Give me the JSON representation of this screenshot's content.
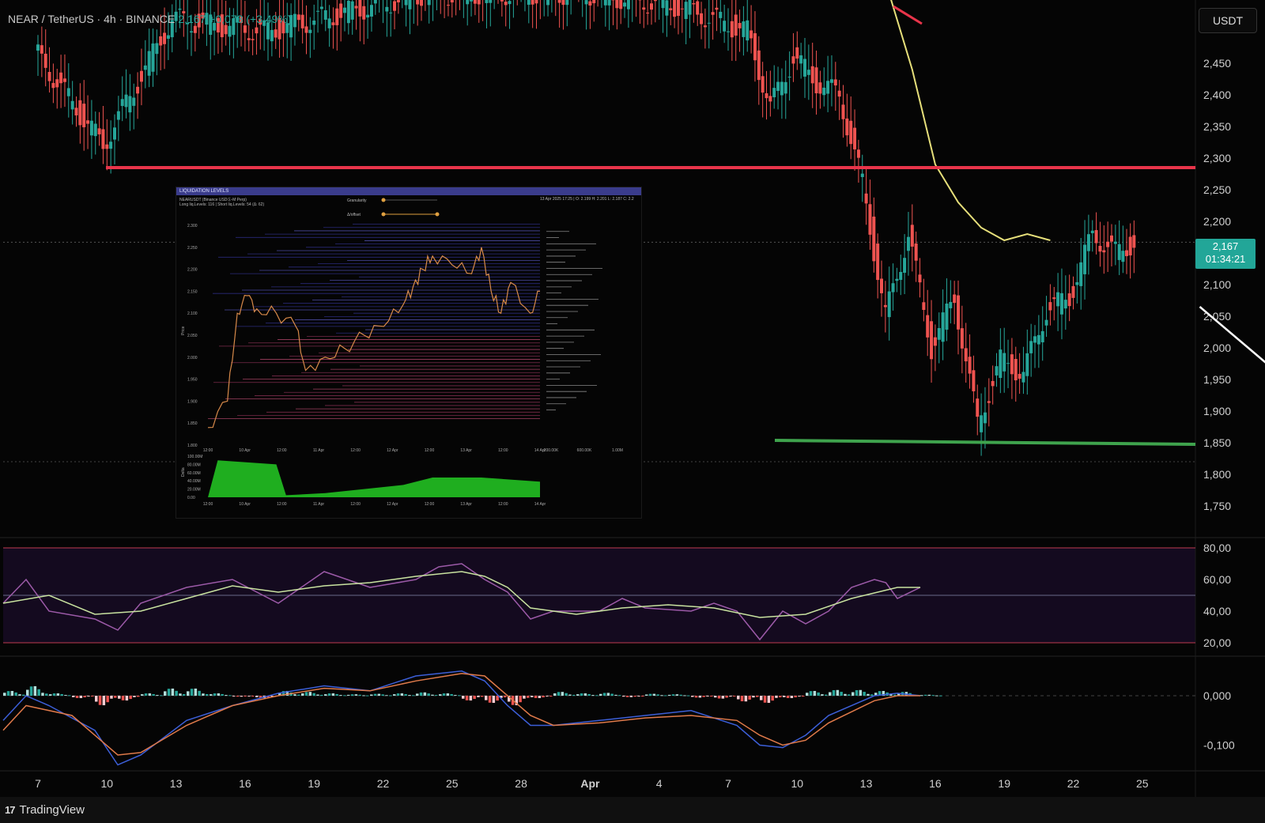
{
  "header": {
    "symbol": "NEAR / TetherUS · 4h · BINANCE",
    "price": "2,167",
    "change": "+0,073 (+3,49%)"
  },
  "currency_button": "USDT",
  "last_price": {
    "price": "2,167",
    "countdown": "01:34:21"
  },
  "footer": {
    "logo_mark": "17",
    "brand": "TradingView"
  },
  "colors": {
    "up": "#26a69a",
    "down": "#ef5350",
    "resistance": "#e8344a",
    "support": "#3fa34d",
    "ma": "#e6df7a",
    "rsi": "#9c5aa8",
    "rsi_ma": "#c9e3a0",
    "macd": "#3c5fd8",
    "signal": "#e07a4a",
    "arrow": "#ffffff"
  },
  "chart_data": [
    {
      "type": "line",
      "name": "price",
      "x": [
        "Mar 7",
        "Mar 10",
        "Mar 13",
        "Mar 16",
        "Mar 19",
        "Mar 22",
        "Mar 25",
        "Mar 28",
        "Apr 1",
        "Apr 4",
        "Apr 7",
        "Apr 10",
        "Apr 13",
        "Apr 16",
        "Apr 19",
        "Apr 22",
        "Apr 25"
      ],
      "x_tick_labels": [
        "7",
        "10",
        "13",
        "16",
        "19",
        "22",
        "25",
        "28",
        "Apr",
        "4",
        "7",
        "10",
        "13",
        "16",
        "19",
        "22",
        "25"
      ],
      "y_tick_labels": [
        "2,450",
        "2,400",
        "2,350",
        "2,300",
        "2,250",
        "2,200",
        "2,100",
        "2,050",
        "2,000",
        "1,950",
        "1,900",
        "1,850",
        "1,800",
        "1,750"
      ],
      "ylim": [
        1720,
        2490
      ],
      "path": [
        [
          0,
          2470
        ],
        [
          3,
          2320
        ],
        [
          6,
          2520
        ],
        [
          10,
          2500
        ],
        [
          17,
          2560
        ],
        [
          24,
          2560
        ],
        [
          28,
          2540
        ],
        [
          31,
          2500
        ],
        [
          32,
          2380
        ],
        [
          33,
          2460
        ],
        [
          34,
          2420
        ],
        [
          35,
          2400
        ],
        [
          36,
          2260
        ],
        [
          37,
          2050
        ],
        [
          38,
          2180
        ],
        [
          39,
          2000
        ],
        [
          40,
          2080
        ],
        [
          41,
          1880
        ],
        [
          42,
          1980
        ],
        [
          43,
          1960
        ],
        [
          44,
          2060
        ],
        [
          45,
          2080
        ],
        [
          46,
          2180
        ],
        [
          47,
          2150
        ],
        [
          47.8,
          2167
        ]
      ],
      "levels": {
        "resistance": 2285,
        "support": 1850,
        "last": 2167,
        "low": 1820
      },
      "moving_average": [
        [
          37,
          2560
        ],
        [
          38,
          2440
        ],
        [
          39,
          2290
        ],
        [
          40,
          2230
        ],
        [
          41,
          2190
        ],
        [
          42,
          2170
        ],
        [
          43,
          2180
        ],
        [
          44,
          2170
        ]
      ],
      "projection": [
        [
          50.5,
          2065
        ],
        [
          56.5,
          1880
        ],
        [
          61.3,
          2415
        ]
      ]
    },
    {
      "type": "line",
      "name": "RSI",
      "y_tick_labels": [
        "80,00",
        "60,00",
        "40,00",
        "20,00"
      ],
      "ylim": [
        15,
        85
      ],
      "bands": [
        80,
        50,
        20
      ],
      "rsi": [
        [
          0,
          45
        ],
        [
          1,
          60
        ],
        [
          2,
          40
        ],
        [
          4,
          35
        ],
        [
          5,
          28
        ],
        [
          6,
          45
        ],
        [
          8,
          55
        ],
        [
          10,
          60
        ],
        [
          12,
          45
        ],
        [
          14,
          65
        ],
        [
          16,
          55
        ],
        [
          18,
          60
        ],
        [
          19,
          68
        ],
        [
          20,
          70
        ],
        [
          21,
          60
        ],
        [
          22,
          52
        ],
        [
          23,
          35
        ],
        [
          24,
          40
        ],
        [
          26,
          40
        ],
        [
          27,
          48
        ],
        [
          28,
          42
        ],
        [
          30,
          40
        ],
        [
          31,
          45
        ],
        [
          32,
          40
        ],
        [
          33,
          22
        ],
        [
          34,
          40
        ],
        [
          35,
          32
        ],
        [
          36,
          40
        ],
        [
          37,
          55
        ],
        [
          38,
          60
        ],
        [
          38.5,
          58
        ],
        [
          39,
          48
        ],
        [
          40,
          55
        ]
      ],
      "ma": [
        [
          0,
          45
        ],
        [
          2,
          50
        ],
        [
          4,
          38
        ],
        [
          6,
          40
        ],
        [
          8,
          48
        ],
        [
          10,
          56
        ],
        [
          12,
          52
        ],
        [
          14,
          56
        ],
        [
          16,
          58
        ],
        [
          18,
          62
        ],
        [
          20,
          65
        ],
        [
          21,
          62
        ],
        [
          22,
          55
        ],
        [
          23,
          42
        ],
        [
          25,
          38
        ],
        [
          27,
          42
        ],
        [
          29,
          44
        ],
        [
          31,
          42
        ],
        [
          33,
          36
        ],
        [
          35,
          38
        ],
        [
          37,
          48
        ],
        [
          39,
          55
        ],
        [
          40,
          55
        ]
      ]
    },
    {
      "type": "bar",
      "name": "MACD",
      "y_tick_labels": [
        "0,000",
        "-0,100"
      ],
      "ylim": [
        -0.14,
        0.05
      ],
      "histogram": [
        [
          0,
          0.01
        ],
        [
          1,
          0.02
        ],
        [
          2,
          0.005
        ],
        [
          3,
          -0.005
        ],
        [
          4,
          -0.02
        ],
        [
          5,
          -0.01
        ],
        [
          6,
          0.005
        ],
        [
          7,
          0.015
        ],
        [
          8,
          0.015
        ],
        [
          9,
          0.005
        ],
        [
          10,
          -0.002
        ],
        [
          11,
          -0.005
        ],
        [
          12,
          0.01
        ],
        [
          13,
          0.008
        ],
        [
          14,
          0.005
        ],
        [
          15,
          0.003
        ],
        [
          16,
          0.004
        ],
        [
          17,
          0.005
        ],
        [
          18,
          0.007
        ],
        [
          19,
          0.005
        ],
        [
          20,
          -0.01
        ],
        [
          21,
          -0.015
        ],
        [
          22,
          -0.02
        ],
        [
          23,
          -0.005
        ],
        [
          24,
          0.008
        ],
        [
          25,
          0.005
        ],
        [
          26,
          0.006
        ],
        [
          27,
          -0.003
        ],
        [
          28,
          0.004
        ],
        [
          29,
          0.003
        ],
        [
          30,
          -0.004
        ],
        [
          31,
          -0.006
        ],
        [
          32,
          -0.012
        ],
        [
          33,
          -0.015
        ],
        [
          34,
          -0.005
        ],
        [
          35,
          0.01
        ],
        [
          36,
          0.012
        ],
        [
          37,
          0.012
        ],
        [
          38,
          0.01
        ],
        [
          39,
          0.008
        ],
        [
          40,
          0.002
        ]
      ],
      "macd": [
        [
          0,
          -0.05
        ],
        [
          1,
          0.0
        ],
        [
          2,
          -0.02
        ],
        [
          4,
          -0.07
        ],
        [
          5,
          -0.14
        ],
        [
          6,
          -0.12
        ],
        [
          8,
          -0.05
        ],
        [
          10,
          -0.02
        ],
        [
          12,
          0.005
        ],
        [
          14,
          0.02
        ],
        [
          16,
          0.01
        ],
        [
          18,
          0.04
        ],
        [
          20,
          0.05
        ],
        [
          21,
          0.03
        ],
        [
          22,
          -0.02
        ],
        [
          23,
          -0.06
        ],
        [
          24,
          -0.06
        ],
        [
          26,
          -0.05
        ],
        [
          28,
          -0.04
        ],
        [
          30,
          -0.03
        ],
        [
          32,
          -0.06
        ],
        [
          33,
          -0.1
        ],
        [
          34,
          -0.105
        ],
        [
          35,
          -0.08
        ],
        [
          36,
          -0.04
        ],
        [
          38,
          0.0
        ],
        [
          39,
          0.005
        ],
        [
          40,
          0.0
        ]
      ],
      "signal": [
        [
          0,
          -0.07
        ],
        [
          1,
          -0.02
        ],
        [
          3,
          -0.04
        ],
        [
          5,
          -0.12
        ],
        [
          6,
          -0.115
        ],
        [
          8,
          -0.06
        ],
        [
          10,
          -0.02
        ],
        [
          12,
          0.0
        ],
        [
          14,
          0.015
        ],
        [
          16,
          0.01
        ],
        [
          18,
          0.03
        ],
        [
          20,
          0.045
        ],
        [
          21,
          0.04
        ],
        [
          22,
          0.0
        ],
        [
          23,
          -0.04
        ],
        [
          24,
          -0.06
        ],
        [
          26,
          -0.055
        ],
        [
          28,
          -0.045
        ],
        [
          30,
          -0.04
        ],
        [
          32,
          -0.05
        ],
        [
          33,
          -0.08
        ],
        [
          34,
          -0.1
        ],
        [
          35,
          -0.09
        ],
        [
          36,
          -0.055
        ],
        [
          38,
          -0.01
        ],
        [
          39,
          0.0
        ],
        [
          40,
          0.0
        ]
      ]
    },
    {
      "type": "line",
      "name": "liquidation levels inset",
      "title": "LIQUIDATION LEVELS",
      "subtitle": "NEARUSDT (Binance USDⓈ-M Perp)",
      "info": "13 Apr 2025 17:25 | O: 2.199 H: 2.201 L: 2.187 C: 2.2",
      "levels_text": "Long liq.Levels: 116 | Short liq.Levels: 54 (Δ: 62)",
      "controls": [
        "Granularity",
        "Δ/offset"
      ],
      "ylabel": "Price",
      "y_tick_labels": [
        "2.300",
        "2.250",
        "2.200",
        "2.150",
        "2.100",
        "2.050",
        "2.000",
        "1.950",
        "1.900",
        "1.850",
        "1.800"
      ],
      "x_tick_labels": [
        "12:00",
        "10 Apr",
        "12:00",
        "11 Apr",
        "12:00",
        "12 Apr",
        "12:00",
        "13 Apr",
        "12:00",
        "14 Apr"
      ],
      "side_tick_labels": [
        "200.00K",
        "600.00K",
        "1.00M",
        "1.40M"
      ],
      "delta_ylabel": "Delta",
      "delta_y_tick_labels": [
        "100.00M",
        "80.00M",
        "60.00M",
        "40.00M",
        "20.00M",
        "0.00"
      ],
      "price": [
        [
          0,
          1.84
        ],
        [
          2,
          1.9
        ],
        [
          3,
          2.1
        ],
        [
          4,
          2.14
        ],
        [
          5,
          2.11
        ],
        [
          7,
          2.1
        ],
        [
          9,
          2.07
        ],
        [
          10,
          1.97
        ],
        [
          12,
          2.0
        ],
        [
          14,
          2.02
        ],
        [
          16,
          2.05
        ],
        [
          18,
          2.07
        ],
        [
          20,
          2.12
        ],
        [
          21,
          2.16
        ],
        [
          22,
          2.2
        ],
        [
          23,
          2.23
        ],
        [
          25,
          2.21
        ],
        [
          27,
          2.19
        ],
        [
          28,
          2.25
        ],
        [
          29,
          2.15
        ],
        [
          30,
          2.1
        ],
        [
          31,
          2.17
        ],
        [
          33,
          2.1
        ],
        [
          34,
          2.15
        ]
      ],
      "price_ylim": [
        1.8,
        2.3
      ],
      "delta": [
        [
          0,
          0
        ],
        [
          1,
          90
        ],
        [
          7,
          80
        ],
        [
          8,
          5
        ],
        [
          12,
          10
        ],
        [
          18,
          25
        ],
        [
          20,
          30
        ],
        [
          23,
          48
        ],
        [
          28,
          48
        ],
        [
          34,
          38
        ]
      ],
      "delta_ylim": [
        0,
        100
      ]
    }
  ]
}
